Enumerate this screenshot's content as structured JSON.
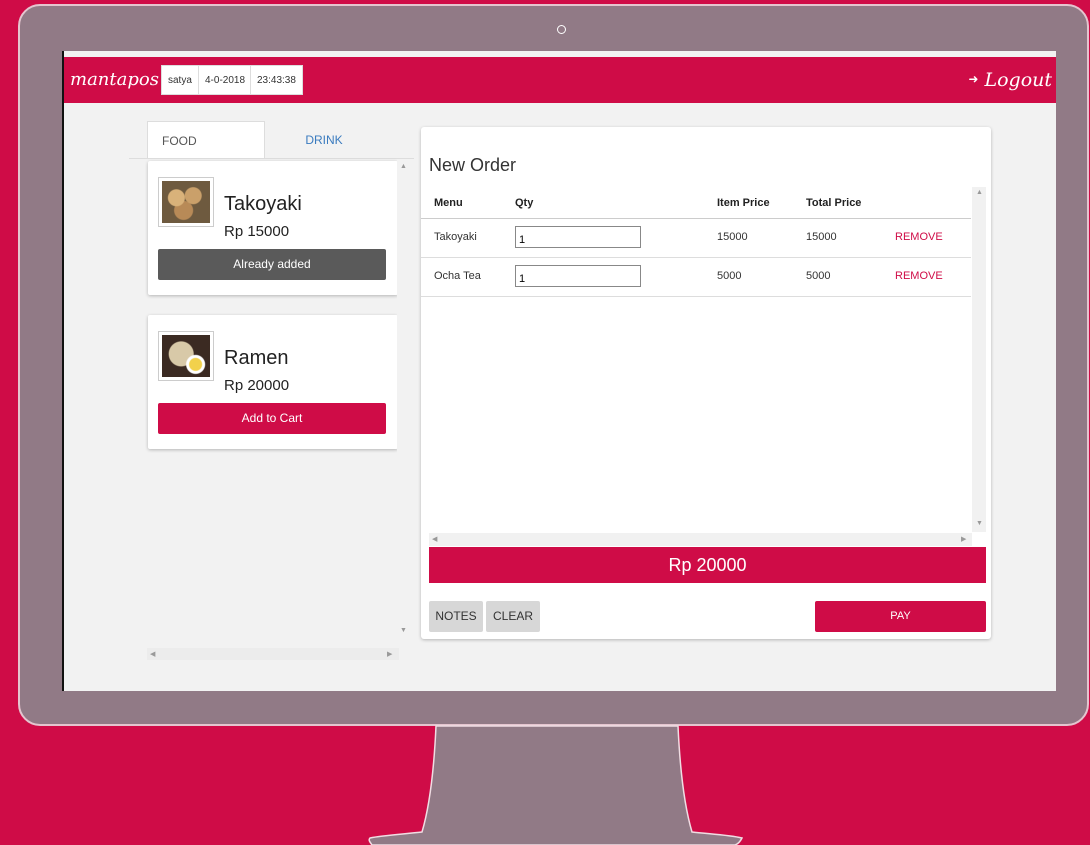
{
  "app": {
    "brand": "mantapos",
    "user": "satya",
    "date": "4-0-2018",
    "time": "23:43:38",
    "logout_label": "Logout",
    "logout_icon": "sign-out-icon"
  },
  "tabs": [
    {
      "label": "FOOD",
      "active": true
    },
    {
      "label": "DRINK",
      "active": false
    }
  ],
  "products": [
    {
      "name": "Takoyaki",
      "price": "Rp 15000",
      "button": "Already added",
      "state": "added",
      "image": "takoyaki-photo"
    },
    {
      "name": "Ramen",
      "price": "Rp 20000",
      "button": "Add to Cart",
      "state": "add",
      "image": "ramen-photo"
    }
  ],
  "order": {
    "title": "New Order",
    "columns": [
      "Menu",
      "Qty",
      "Item Price",
      "Total Price"
    ],
    "rows": [
      {
        "menu": "Takoyaki",
        "qty": "1",
        "item_price": "15000",
        "total_price": "15000",
        "action": "REMOVE"
      },
      {
        "menu": "Ocha Tea",
        "qty": "1",
        "item_price": "5000",
        "total_price": "5000",
        "action": "REMOVE"
      }
    ],
    "total": "Rp 20000",
    "notes_label": "NOTES",
    "clear_label": "CLEAR",
    "pay_label": "PAY"
  },
  "colors": {
    "accent": "#cf0c47",
    "frame": "#917a86",
    "added_button": "#5a5a5a"
  }
}
